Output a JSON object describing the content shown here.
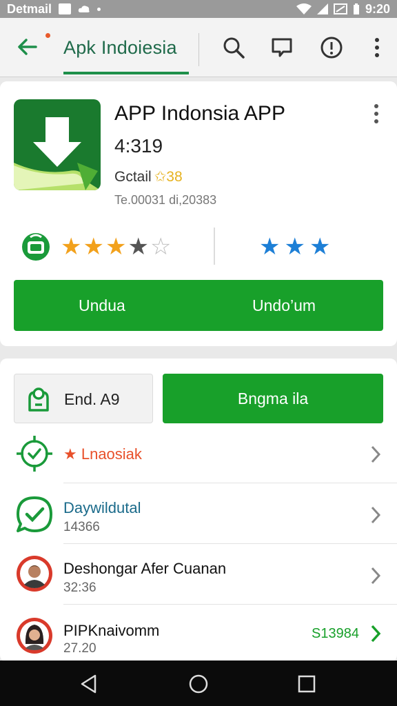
{
  "status_bar": {
    "carrier": "Detmail",
    "time": "9:20",
    "icons": [
      "image-icon",
      "cloud-icon",
      "notification-dot-icon",
      "wifi-icon",
      "signal-icon",
      "data-icon",
      "battery-icon"
    ]
  },
  "app_bar": {
    "title": "Apk Indoiesia",
    "icons": [
      "back-arrow-icon",
      "search-icon",
      "message-icon",
      "info-icon",
      "overflow-menu-icon"
    ]
  },
  "app_card": {
    "name": "APP Indonsia APP",
    "version": "4:319",
    "developer": "Gctail",
    "developer_badge": "✩38",
    "meta": "Te.00031 di,20383",
    "rating_left_stars": 3.5,
    "rating_right_stars": 3,
    "button_left_label": "Undua",
    "button_right_label": "Undo’um"
  },
  "action_row": {
    "end_label": "End. A9",
    "green_button_label": "Bngma ila"
  },
  "list": [
    {
      "title": "Lnaosiak",
      "subtitle": "",
      "title_color": "#e8502a",
      "icon": "target-check-icon"
    },
    {
      "title": "Daywildutal",
      "subtitle": "14366",
      "title_color": "#1a6a8a",
      "icon": "chat-check-icon"
    },
    {
      "title": "Deshongar Afer Cuanan",
      "subtitle": "32:36",
      "title_color": "#111111",
      "icon": "avatar-man-icon"
    },
    {
      "title": "PIPKnaivomm",
      "subtitle": "27.20",
      "title_color": "#111111",
      "icon": "avatar-woman-icon",
      "price": "S13984"
    }
  ],
  "colors": {
    "accent_green": "#18a02a",
    "dark_green": "#1f6a4a",
    "star_orange": "#f2a11c",
    "star_blue": "#1d7fd6",
    "status_bar": "#9a9a9a"
  },
  "nav_bar": {
    "icons": [
      "nav-back-icon",
      "nav-home-icon",
      "nav-recents-icon"
    ]
  }
}
